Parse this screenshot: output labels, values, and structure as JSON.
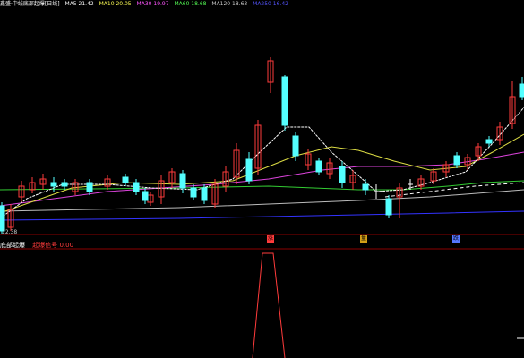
{
  "header": {
    "title": "鑫盛·中线底部起爆[日线]",
    "ma5": "MA5 21.42",
    "ma10": "MA10 20.05",
    "ma30": "MA30 19.97",
    "ma60": "MA60 18.68",
    "ma120": "MA120 18.63",
    "ma250": "MA250 16.42",
    "colors": {
      "title": "#ffffff",
      "ma5": "#ffffff",
      "ma10": "#ffff55",
      "ma30": "#ff55ff",
      "ma60": "#55ff55",
      "ma120": "#cccccc",
      "ma250": "#5555ff"
    }
  },
  "price_low_label": "12.38",
  "markers": [
    {
      "label": "涨",
      "color": "#ff3b3b"
    },
    {
      "label": "量",
      "color": "#d4a017"
    },
    {
      "label": "跌",
      "color": "#5577ff"
    }
  ],
  "indicator": {
    "name": "底部起爆",
    "value_label": "起爆信号 0.00",
    "name_color": "#ffffff",
    "value_color": "#ff3b3b"
  },
  "colors": {
    "up": "#ff3b3b",
    "down": "#54ffff",
    "grid": "#8b0000",
    "background": "#000000"
  }
}
